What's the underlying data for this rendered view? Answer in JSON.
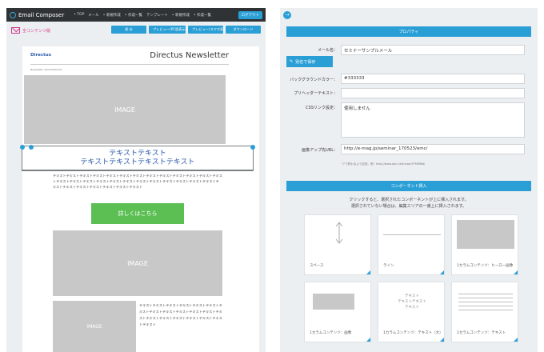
{
  "left": {
    "app_name": "Email Composer",
    "nav": [
      "• TOP",
      "メール",
      "• 新規作成",
      "• 作成一覧",
      "テンプレート",
      "• 新規作成",
      "• 作成一覧"
    ],
    "logout": "ログアウト",
    "template_label": "全コンテンツ版",
    "buttons": {
      "save": "保 存",
      "preview_pc": "プレビュー(PC版表示/ソース)",
      "preview_sp": "プレビュー(スマホ表示/ソース)",
      "download": "ダウンロード"
    },
    "newsletter": {
      "logo": "Directus",
      "title": "Directus Newsletter",
      "date": "Newsletter 2015/03/03 No."
    },
    "image_label": "IMAGE",
    "heading_lines": [
      "テキストテキスト",
      "テキストテキストテキストテキスト"
    ],
    "body_text": "テキストテキストテキストテキストテキストテキストテキストテキストテキストテキストテキストテキストテキストテキストテキストテキストテキストテキストテキストテキストテキストテキストテキストテキストテキストテキストテキストテキストテキストテキストテキストテキスト",
    "cta": "詳しくはこちら",
    "side_text": "テキストテキストテキストテキストテキストテキストテキストテキストテキストテキストテキストテキストテキストテキストテキストテキストテキストテキストテキストテキスト"
  },
  "right": {
    "property_title": "プロパティ",
    "fields": {
      "mail_name_label": "メール名：",
      "mail_name_value": "セミナーサンプルメール",
      "save_as": "別名で保存",
      "bg_color_label": "バックグラウンドカラー：",
      "bg_color_value": "#333333",
      "preheader_label": "プリヘッダーテキスト：",
      "preheader_value": "",
      "css_label": "CSSリンク設定：",
      "css_value": "使用しません",
      "image_url_label": "画像アップ先URL：",
      "image_url_value": "http://e-mag.jp/seminar_170523/emc/",
      "note": "\"/\"で終わるよう記述。例）http://www.abc.net/news/YYMMNN/"
    },
    "insert_title": "コンポーネント挿入",
    "insert_help": [
      "クリックすると、選択されたコンポーネントが上に挿入されます。",
      "選択されていない場合は、編集エリアの一番上に挿入されます。"
    ],
    "components": [
      "スペース",
      "ライン",
      "1カラムコンテンツ：ヒーロー画像",
      "1カラムコンテンツ：画像",
      "1カラムコンテンツ：テキスト（大）",
      "1カラムコンテンツ：テキスト"
    ],
    "component_preview_text": [
      "テキスト",
      "テキストテキスト",
      "テキスト"
    ]
  }
}
